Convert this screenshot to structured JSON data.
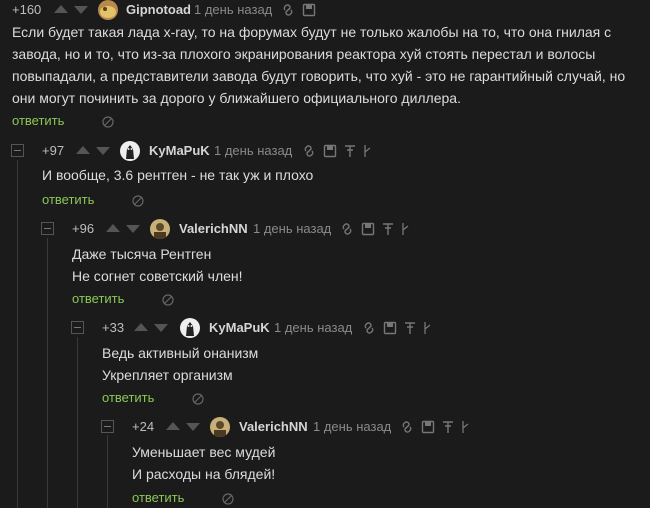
{
  "comments": [
    {
      "rating": "+160",
      "author": "Gipnotoad",
      "date": "1 день назад",
      "text": [
        "Если будет такая лада x-ray, то на форумах будут не только жалобы на то, что она гнилая с завода, но и то, что из-за плохого экранирования реактора хуй стоять перестал и волосы повыпадали, а представители завода будут говорить, что хуй - это не гарантийный случай, но они могут починить за дорого у ближайшего официального диллера."
      ],
      "reply": "ответить"
    },
    {
      "rating": "+97",
      "author": "KyMaPuK",
      "date": "1 день назад",
      "text": [
        "И вообще, 3.6 рентген - не так уж и плохо"
      ],
      "reply": "ответить"
    },
    {
      "rating": "+96",
      "author": "ValerichNN",
      "date": "1 день назад",
      "text": [
        "Даже тысяча Рентген",
        "Не согнет советский член!"
      ],
      "reply": "ответить"
    },
    {
      "rating": "+33",
      "author": "KyMaPuK",
      "date": "1 день назад",
      "text": [
        "Ведь активный онанизм",
        "Укрепляет организм"
      ],
      "reply": "ответить"
    },
    {
      "rating": "+24",
      "author": "ValerichNN",
      "date": "1 день назад",
      "text": [
        "Уменьшает вес мудей",
        "И расходы на блядей!"
      ],
      "reply": "ответить"
    }
  ],
  "icons": {
    "vote_up": "arrow-up-icon",
    "vote_down": "arrow-down-icon",
    "link": "link-icon",
    "save": "save-icon",
    "pin": "pin-icon",
    "branch": "branch-icon",
    "hide": "hide-icon",
    "collapse": "collapse-icon"
  },
  "colors": {
    "background": "#1b1b1b",
    "text": "#dcdcdc",
    "reply_link": "#8ac858",
    "muted": "#8a8a8a"
  }
}
